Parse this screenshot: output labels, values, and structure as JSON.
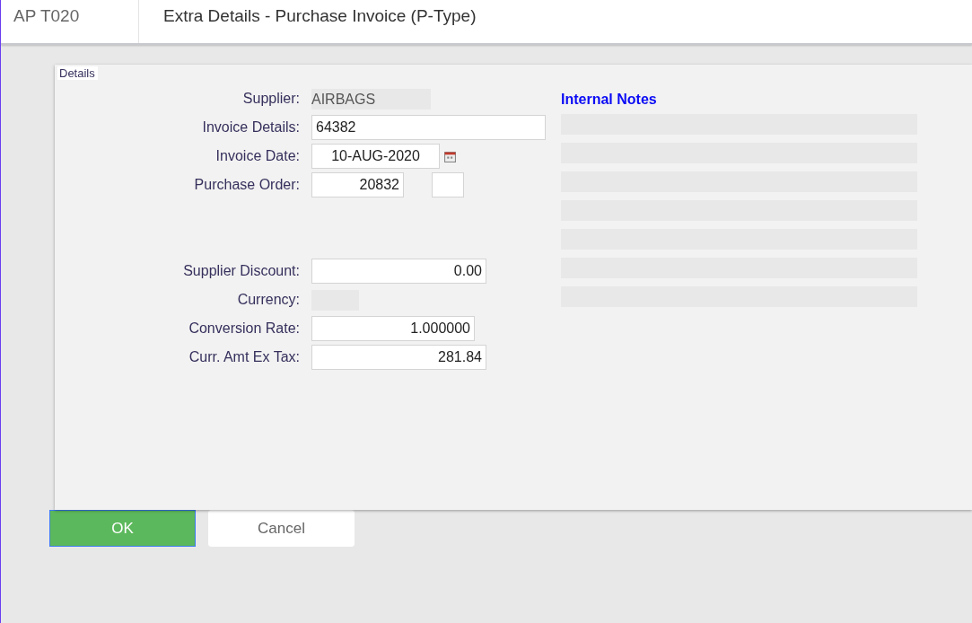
{
  "header": {
    "code": "AP T020",
    "title": "Extra Details - Purchase Invoice (P-Type)"
  },
  "details": {
    "legend": "Details",
    "fields": [
      {
        "kind": "readonly",
        "label": "Supplier:",
        "value": "AIRBAGS"
      },
      {
        "kind": "text",
        "label": "Invoice Details:",
        "value": "64382"
      },
      {
        "kind": "date",
        "label": "Invoice Date:",
        "value": "10-AUG-2020"
      },
      {
        "kind": "order",
        "label": "Purchase Order:",
        "value": "20832"
      },
      {
        "kind": "gap"
      },
      {
        "kind": "number",
        "label": "Supplier Discount:",
        "value": "0.00"
      },
      {
        "kind": "readonly",
        "label": "Currency:"
      },
      {
        "kind": "number",
        "label": "Conversion Rate:",
        "value": "1.000000"
      },
      {
        "kind": "number",
        "label": "Curr. Amt Ex Tax:",
        "value": "281.84"
      }
    ],
    "notes": {
      "title": "Internal Notes"
    }
  },
  "buttons": [
    {
      "kind": "primary",
      "label": "OK",
      "focused": true
    },
    {
      "kind": "secondary",
      "label": "Cancel",
      "focused": false
    }
  ]
}
